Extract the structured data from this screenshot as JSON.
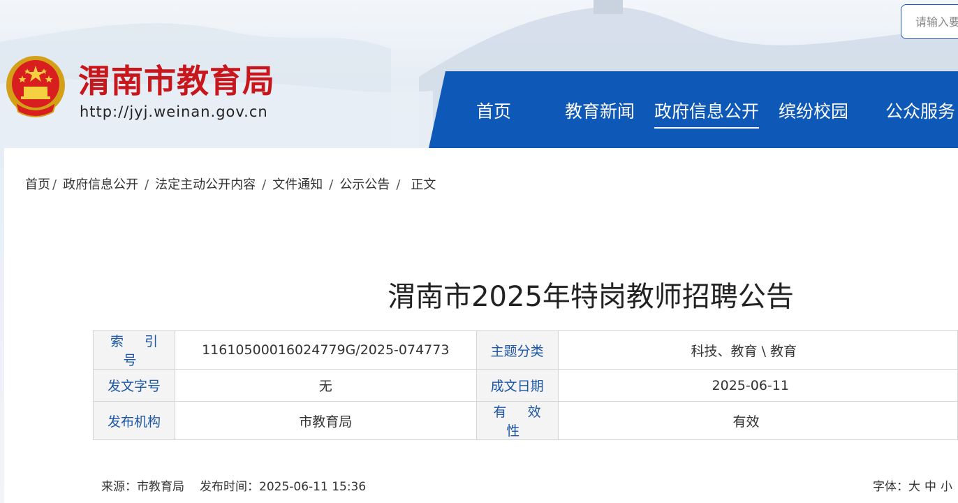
{
  "header": {
    "site_title": "渭南市教育局",
    "site_url": "http://jyj.weinan.gov.cn",
    "emblem_icon": "national-emblem-icon",
    "search_placeholder": "请输入要"
  },
  "nav": {
    "items": [
      {
        "label": "首页"
      },
      {
        "label": "教育新闻"
      },
      {
        "label": "政府信息公开",
        "active": true
      },
      {
        "label": "缤纷校园"
      },
      {
        "label": "公众服务"
      }
    ]
  },
  "breadcrumb": {
    "items": [
      "首页",
      "政府信息公开",
      "法定主动公开内容",
      "文件通知",
      "公示公告",
      "正文"
    ],
    "separator": "/"
  },
  "article": {
    "title": "渭南市2025年特岗教师招聘公告",
    "info": {
      "index_label": "索 引 号",
      "index_value": "11610500016024779G/2025-074773",
      "topic_label": "主题分类",
      "topic_value": "科技、教育 \\ 教育",
      "docno_label": "发文字号",
      "docno_value": "无",
      "date_label": "成文日期",
      "date_value": "2025-06-11",
      "org_label": "发布机构",
      "org_value": "市教育局",
      "valid_label": "有 效 性",
      "valid_value": "有效"
    },
    "meta": {
      "source": "来源：市教育局",
      "publish_time": "发布时间：2025-06-11 15:36",
      "font_label": "字体：",
      "font_large": "大",
      "font_medium": "中",
      "font_small": "小"
    }
  },
  "colors": {
    "brand_red": "#c8161d",
    "nav_blue": "#0e58b8",
    "label_blue": "#1c56a8"
  }
}
